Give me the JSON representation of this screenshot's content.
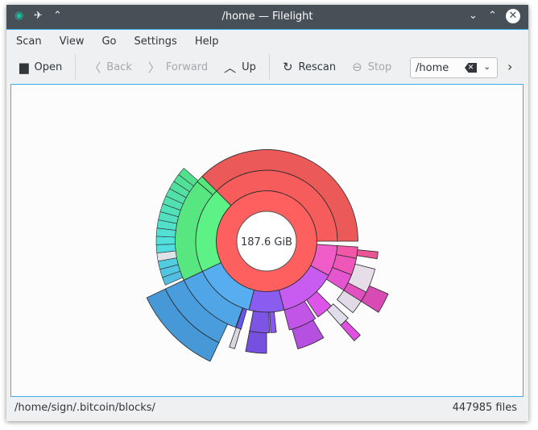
{
  "window": {
    "title": "/home — Filelight"
  },
  "menu": [
    "Scan",
    "View",
    "Go",
    "Settings",
    "Help"
  ],
  "toolbar": {
    "open": "Open",
    "back": "Back",
    "forward": "Forward",
    "up": "Up",
    "rescan": "Rescan",
    "stop": "Stop",
    "path_value": "/home"
  },
  "map": {
    "center_label": "187.6 GiB",
    "segments": [
      {
        "depth": 1,
        "start": 0,
        "end": 100,
        "color": "#fe5f5f"
      },
      {
        "depth": 2,
        "start": 62.5,
        "end": 100,
        "color": "#f65c5c"
      },
      {
        "depth": 3,
        "start": 62.5,
        "end": 100,
        "color": "#ec5959"
      },
      {
        "depth": 2,
        "start": 43,
        "end": 62.5,
        "color": "#5cf286"
      },
      {
        "depth": 3,
        "start": 43,
        "end": 61.3,
        "color": "#57e680"
      },
      {
        "depth": 3,
        "start": 61.3,
        "end": 62.5,
        "color": "#55e67c"
      },
      {
        "depth": 2,
        "start": 29,
        "end": 43,
        "color": "#56adf0"
      },
      {
        "depth": 3,
        "start": 30.5,
        "end": 43,
        "color": "#4fa5e6"
      },
      {
        "depth": 4,
        "start": 32,
        "end": 43,
        "color": "#4a9ddc"
      },
      {
        "depth": 5,
        "start": 32,
        "end": 43,
        "color": "#4798d6"
      },
      {
        "depth": 3,
        "start": 29.5,
        "end": 30.4,
        "color": "#6658ea"
      },
      {
        "depth": 4,
        "start": 29.6,
        "end": 30.4,
        "color": "#d9d6e2"
      },
      {
        "depth": 2,
        "start": 21,
        "end": 29,
        "color": "#8a5cf0"
      },
      {
        "depth": 3,
        "start": 24.5,
        "end": 28,
        "color": "#7c55e4"
      },
      {
        "depth": 4,
        "start": 25,
        "end": 28,
        "color": "#7850e0"
      },
      {
        "depth": 3,
        "start": 23.3,
        "end": 24.3,
        "color": "#8a58ea"
      },
      {
        "depth": 2,
        "start": 8,
        "end": 21,
        "color": "#c85cf0"
      },
      {
        "depth": 3,
        "start": 16,
        "end": 21,
        "color": "#c055e8"
      },
      {
        "depth": 4,
        "start": 16.5,
        "end": 20.5,
        "color": "#b650e0"
      },
      {
        "depth": 3,
        "start": 12.5,
        "end": 15.5,
        "color": "#dc55e8"
      },
      {
        "depth": 4,
        "start": 12,
        "end": 13.5,
        "color": "#e0ddea"
      },
      {
        "depth": 5,
        "start": 12.5,
        "end": 13.5,
        "color": "#e050e0"
      },
      {
        "depth": 2,
        "start": 1,
        "end": 8,
        "color": "#f05cc8"
      },
      {
        "depth": 3,
        "start": 6,
        "end": 9,
        "color": "#e455d0"
      },
      {
        "depth": 4,
        "start": 8,
        "end": 11,
        "color": "#e2dae6"
      },
      {
        "depth": 3,
        "start": 3,
        "end": 6,
        "color": "#ee57b8"
      },
      {
        "depth": 4,
        "start": 6,
        "end": 9,
        "color": "#e250c0"
      },
      {
        "depth": 5,
        "start": 6.5,
        "end": 9,
        "color": "#d84bb4"
      },
      {
        "depth": 3,
        "start": 1,
        "end": 3,
        "color": "#f257a8"
      },
      {
        "depth": 4,
        "start": 4,
        "end": 7.5,
        "color": "#e6dde8"
      },
      {
        "depth": 4,
        "start": 1.5,
        "end": 2.5,
        "color": "#ea5598"
      }
    ]
  },
  "status": {
    "path": "/home/sign/.bitcoin/blocks/",
    "files": "447985 files"
  }
}
